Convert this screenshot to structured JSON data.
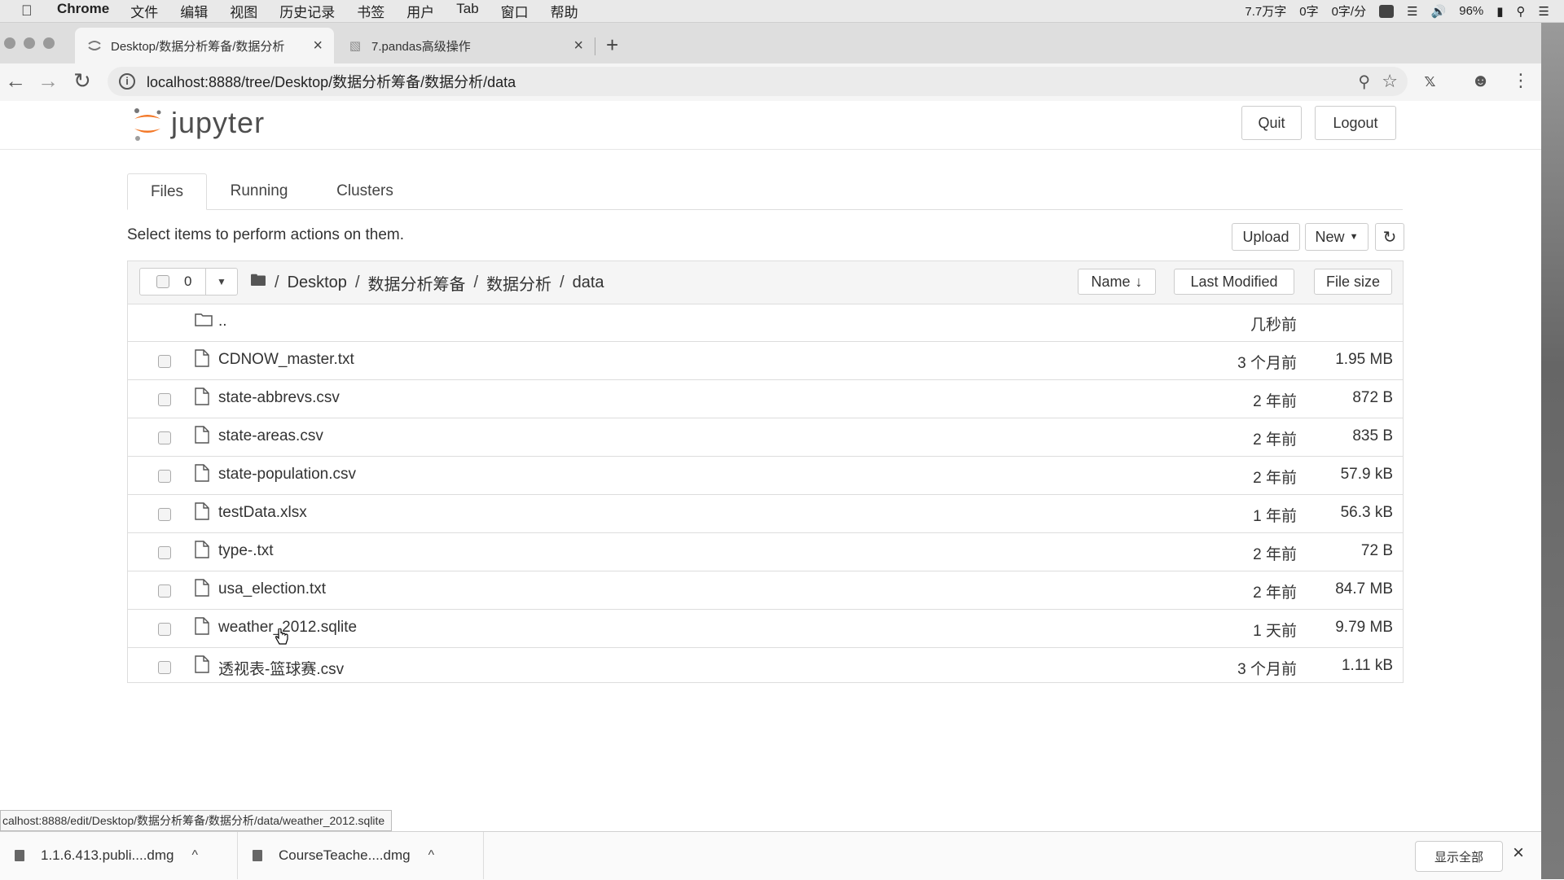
{
  "menubar": {
    "app": "Chrome",
    "items": [
      "文件",
      "编辑",
      "视图",
      "历史记录",
      "书签",
      "用户",
      "Tab",
      "窗口",
      "帮助"
    ],
    "status_texts": [
      "7.7万字",
      "0字",
      "0字/分",
      "96%"
    ]
  },
  "browser": {
    "tabs": [
      {
        "title": "Desktop/数据分析筹备/数据分析",
        "active": true
      },
      {
        "title": "7.pandas高级操作",
        "active": false
      }
    ],
    "url": "localhost:8888/tree/Desktop/数据分析筹备/数据分析/data"
  },
  "jupyter": {
    "logo_text": "jupyter",
    "quit_label": "Quit",
    "logout_label": "Logout",
    "tabs": [
      "Files",
      "Running",
      "Clusters"
    ],
    "instructions": "Select items to perform actions on them.",
    "upload_label": "Upload",
    "new_label": "New",
    "selected_count": "0",
    "breadcrumb": [
      "Desktop",
      "数据分析筹备",
      "数据分析",
      "data"
    ],
    "columns": {
      "name": "Name",
      "modified": "Last Modified",
      "size": "File size"
    },
    "parent": {
      "name": "..",
      "modified": "几秒前"
    },
    "files": [
      {
        "name": "CDNOW_master.txt",
        "modified": "3 个月前",
        "size": "1.95 MB"
      },
      {
        "name": "state-abbrevs.csv",
        "modified": "2 年前",
        "size": "872 B"
      },
      {
        "name": "state-areas.csv",
        "modified": "2 年前",
        "size": "835 B"
      },
      {
        "name": "state-population.csv",
        "modified": "2 年前",
        "size": "57.9 kB"
      },
      {
        "name": "testData.xlsx",
        "modified": "1 年前",
        "size": "56.3 kB"
      },
      {
        "name": "type-.txt",
        "modified": "2 年前",
        "size": "72 B"
      },
      {
        "name": "usa_election.txt",
        "modified": "2 年前",
        "size": "84.7 MB"
      },
      {
        "name": "weather_2012.sqlite",
        "modified": "1 天前",
        "size": "9.79 MB"
      },
      {
        "name": "透视表-篮球赛.csv",
        "modified": "3 个月前",
        "size": "1.11 kB"
      }
    ]
  },
  "status_url": "calhost:8888/edit/Desktop/数据分析筹备/数据分析/data/weather_2012.sqlite",
  "downloads": {
    "items": [
      {
        "name": "1.1.6.413.publi....dmg"
      },
      {
        "name": "CourseTeache....dmg"
      }
    ],
    "show_all": "显示全部"
  },
  "icons": {
    "apple": "apple-icon",
    "back": "back-arrow-icon",
    "forward": "forward-arrow-icon",
    "reload": "reload-icon",
    "info": "info-icon",
    "zoom": "zoom-icon",
    "star": "star-icon",
    "folder": "folder-icon",
    "file": "file-icon",
    "refresh": "refresh-icon",
    "sort": "arrow-down-icon",
    "close": "close-icon",
    "download": "download-file-icon"
  },
  "colors": {
    "jupyter_orange": "#f37726",
    "border": "#dddddd",
    "header_bg": "#f5f5f5"
  }
}
